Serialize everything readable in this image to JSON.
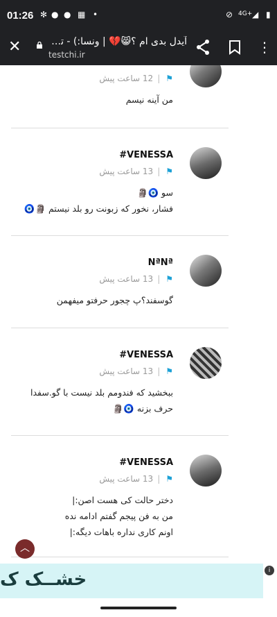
{
  "status": {
    "time": "01:26",
    "network": "4G+"
  },
  "browser": {
    "title": "آیدل بدی ام ؟😸💔 | ونسا:) - تس..",
    "url": "testchi.ir"
  },
  "comments": [
    {
      "author": "",
      "time": "12 ساعت پیش",
      "lines": [
        "من آینه نیسم"
      ]
    },
    {
      "author": "#VENESSA",
      "time": "13 ساعت پیش",
      "lines": [
        "سو 🧿🗿",
        "فشار، نخور که زبونت رو بلد نیستم 🗿🧿"
      ]
    },
    {
      "author": "NªNª",
      "time": "13 ساعت پیش",
      "lines": [
        "گوسفند؟پ چجور حرفتو میفهمن"
      ]
    },
    {
      "author": "#VENESSA",
      "time": "13 ساعت پیش",
      "lines": [
        "ببخشید که فندومم بلد نیست با گو.سفدا",
        "حرف بزنه 🧿🗿"
      ]
    },
    {
      "author": "#VENESSA",
      "time": "13 ساعت پیش",
      "lines": [
        "دختر حالت کی هست اصن:|",
        "من به فن پیجم گفتم ادامه نده",
        "اونم کاری نداره باهات دیگه:|"
      ]
    }
  ],
  "banner": {
    "text": "خشــک ک"
  },
  "ad_badge": "i"
}
